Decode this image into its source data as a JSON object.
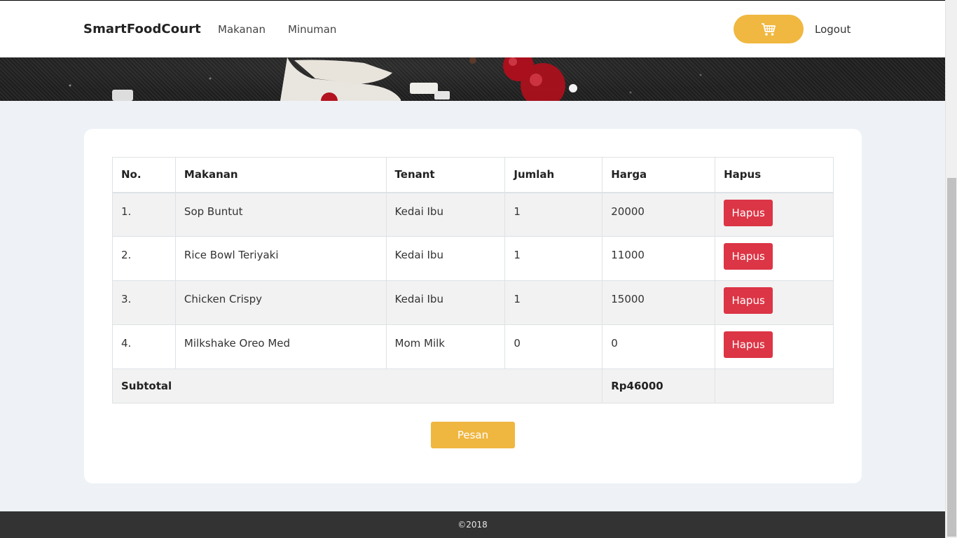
{
  "navbar": {
    "brand": "SmartFoodCourt",
    "links": [
      "Makanan",
      "Minuman"
    ],
    "cart_icon": "cart-icon",
    "logout": "Logout"
  },
  "table": {
    "headers": [
      "No.",
      "Makanan",
      "Tenant",
      "Jumlah",
      "Harga",
      "Hapus"
    ],
    "rows": [
      {
        "no": "1.",
        "makanan": "Sop Buntut",
        "tenant": "Kedai Ibu",
        "jumlah": "1",
        "harga": "20000",
        "hapus": "Hapus"
      },
      {
        "no": "2.",
        "makanan": "Rice Bowl Teriyaki",
        "tenant": "Kedai Ibu",
        "jumlah": "1",
        "harga": "11000",
        "hapus": "Hapus"
      },
      {
        "no": "3.",
        "makanan": "Chicken Crispy",
        "tenant": "Kedai Ibu",
        "jumlah": "1",
        "harga": "15000",
        "hapus": "Hapus"
      },
      {
        "no": "4.",
        "makanan": "Milkshake Oreo Med",
        "tenant": "Mom Milk",
        "jumlah": "0",
        "harga": "0",
        "hapus": "Hapus"
      }
    ],
    "subtotal_label": "Subtotal",
    "subtotal_value": "Rp46000"
  },
  "order_button": "Pesan",
  "footer": "©2018",
  "colors": {
    "accent": "#f0b840",
    "danger": "#dc3545",
    "footer_bg": "#333333",
    "page_bg": "#eef2f6"
  }
}
